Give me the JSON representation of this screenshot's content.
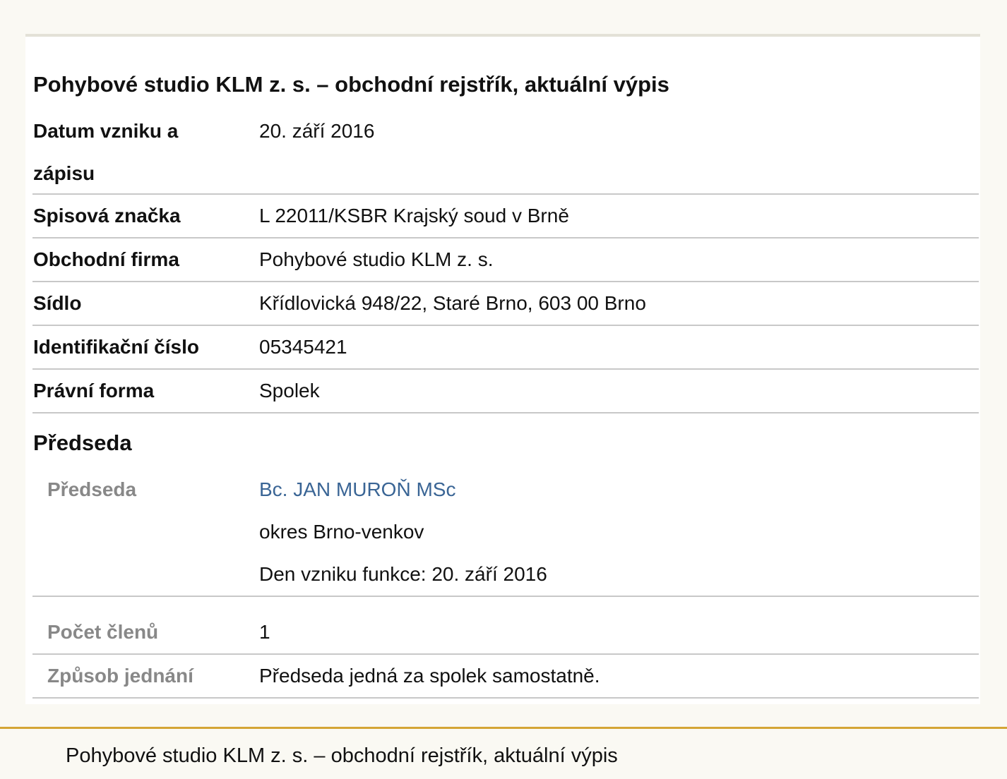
{
  "title": "Pohybové studio KLM z. s. – obchodní rejstřík, aktuální výpis",
  "rows": [
    {
      "label": "Datum vzniku a zápisu",
      "value": "20. září 2016"
    },
    {
      "label": "Spisová značka",
      "value": "L 22011/KSBR Krajský soud v Brně"
    },
    {
      "label": "Obchodní firma",
      "value": "Pohybové studio KLM z. s."
    },
    {
      "label": "Sídlo",
      "value": "Křídlovická 948/22, Staré Brno, 603 00 Brno"
    },
    {
      "label": "Identifikační číslo",
      "value": "05345421"
    },
    {
      "label": "Právní forma",
      "value": "Spolek"
    }
  ],
  "section": {
    "title": "Předseda",
    "member": {
      "label": "Předseda",
      "name": "Bc. JAN MUROŇ MSc",
      "district": "okres Brno-venkov",
      "since": "Den vzniku funkce: 20. září 2016"
    },
    "count_label": "Počet členů",
    "count_value": "1",
    "method_label": "Způsob jednání",
    "method_value": "Předseda jedná za spolek samostatně."
  },
  "footer": {
    "text": "Pohybové studio KLM z. s. – obchodní rejstřík, aktuální výpis"
  },
  "colors": {
    "link": "#3a6595",
    "accent": "#d4a535",
    "muted_label": "#888888"
  }
}
